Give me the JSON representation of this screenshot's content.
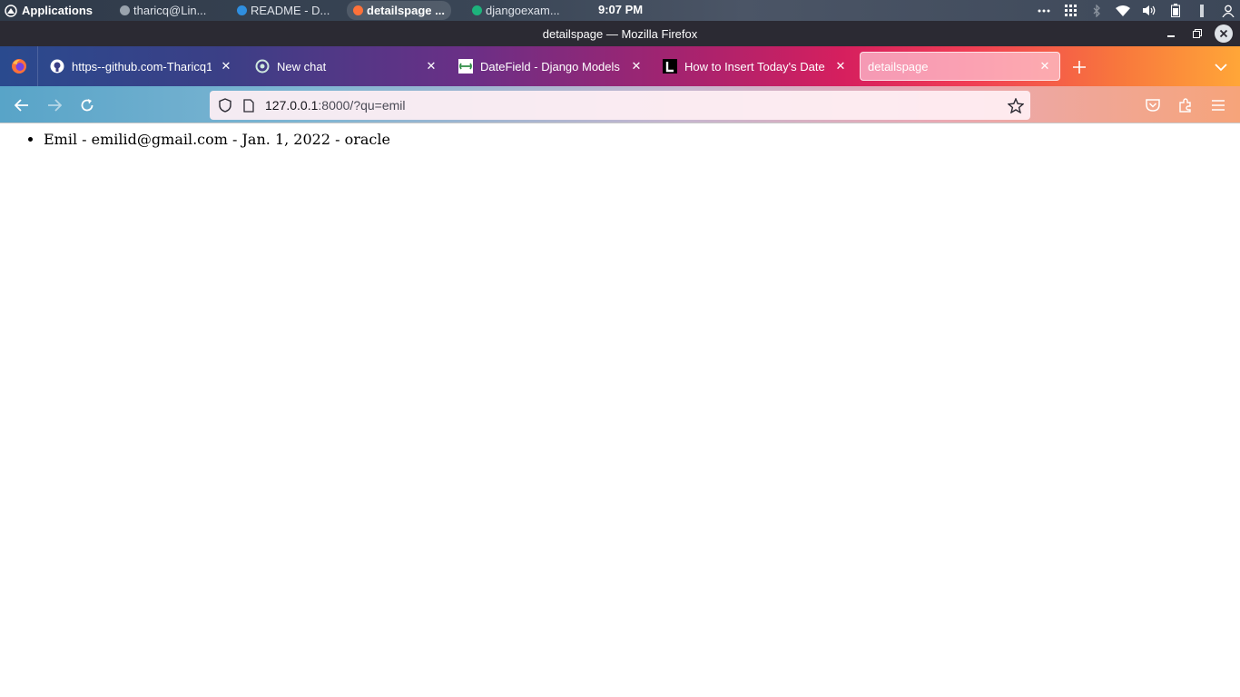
{
  "os_panel": {
    "applications_label": "Applications",
    "tasks": [
      {
        "label": "tharicq@Lin...",
        "icon": "terminal-icon",
        "active": false
      },
      {
        "label": "README - D...",
        "icon": "vscode-icon",
        "active": false
      },
      {
        "label": "detailspage ...",
        "icon": "firefox-icon",
        "active": true
      },
      {
        "label": "djangoexam...",
        "icon": "pycharm-icon",
        "active": false
      }
    ],
    "clock": "9:07 PM"
  },
  "window": {
    "title": "detailspage — Mozilla Firefox"
  },
  "tabs": [
    {
      "label": "https--github.com-Tharicq1",
      "icon": "github-icon"
    },
    {
      "label": "New chat",
      "icon": "chatgpt-icon"
    },
    {
      "label": "DateField - Django Models -",
      "icon": "geeksforgeeks-icon"
    },
    {
      "label": "How to Insert Today's Date i",
      "icon": "letter-l-icon"
    },
    {
      "label": "detailspage",
      "icon": "",
      "selected": true
    }
  ],
  "urlbar": {
    "host": "127.0.0.1",
    "rest": ":8000/?qu=emil"
  },
  "page": {
    "items": [
      "Emil - emilid@gmail.com - Jan. 1, 2022 - oracle"
    ]
  },
  "colors": {
    "accent_pink": "#f03d55",
    "accent_orange": "#ffa638",
    "accent_blue": "#2a4a8e"
  }
}
